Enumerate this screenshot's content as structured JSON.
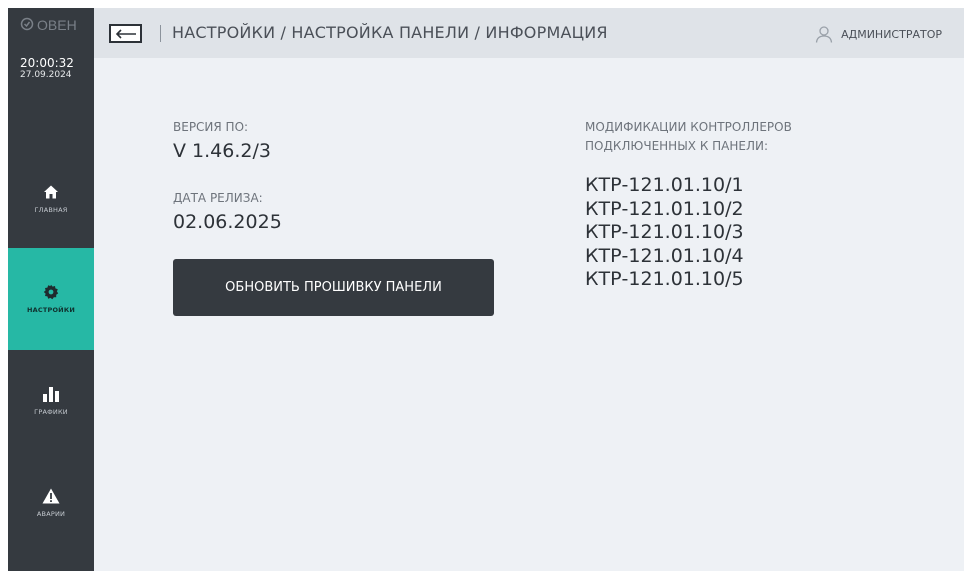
{
  "sidebar": {
    "logo_text": "ОВЕН",
    "time": "20:00:32",
    "date": "27.09.2024",
    "items": [
      {
        "label": "ГЛАВНАЯ",
        "icon": "home-icon"
      },
      {
        "label": "НАСТРОЙКИ",
        "icon": "gear-icon",
        "active": true
      },
      {
        "label": "ГРАФИКИ",
        "icon": "bar-chart-icon"
      },
      {
        "label": "АВАРИИ",
        "icon": "warning-icon"
      }
    ]
  },
  "header": {
    "breadcrumb": "НАСТРОЙКИ / НАСТРОЙКА ПАНЕЛИ / ИНФОРМАЦИЯ",
    "user": "АДМИНИСТРАТОР"
  },
  "info": {
    "version_label": "ВЕРСИЯ ПО:",
    "version_value": "V 1.46.2/3",
    "release_label": "ДАТА РЕЛИЗА:",
    "release_value": "02.06.2025",
    "update_button": "ОБНОВИТЬ ПРОШИВКУ ПАНЕЛИ"
  },
  "controllers": {
    "label_line1": "МОДИФИКАЦИИ КОНТРОЛЛЕРОВ",
    "label_line2": "ПОДКЛЮЧЕННЫХ К ПАНЕЛИ:",
    "items": [
      "КТР-121.01.10/1",
      "КТР-121.01.10/2",
      "КТР-121.01.10/3",
      "КТР-121.01.10/4",
      "КТР-121.01.10/5"
    ]
  },
  "colors": {
    "sidebar": "#353a40",
    "accent": "#26b8a5",
    "header": "#dfe3e8",
    "content": "#eef1f5"
  }
}
